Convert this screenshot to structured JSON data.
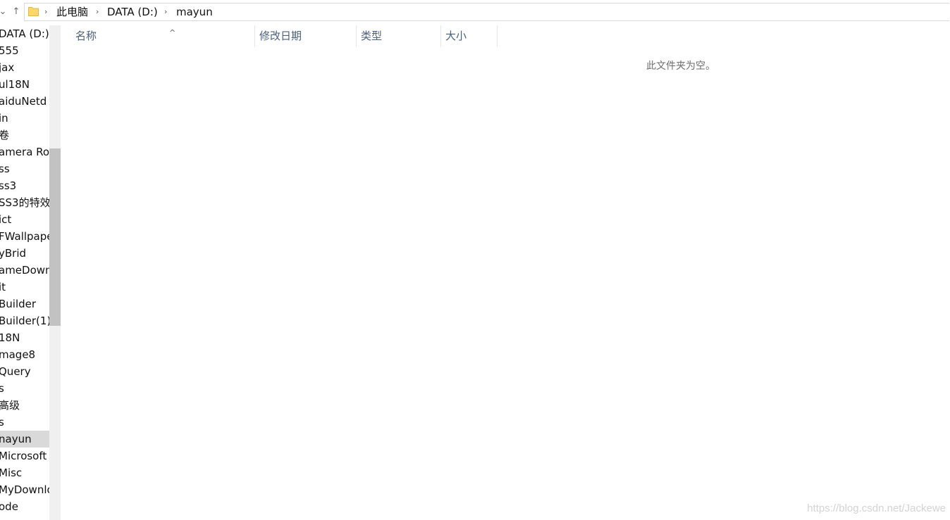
{
  "address_bar": {
    "back_glyph": "⌄",
    "up_glyph": "↑",
    "crumbs": [
      "此电脑",
      "DATA (D:)",
      "mayun"
    ],
    "separator": "›"
  },
  "nav_pane": {
    "items": [
      "DATA (D:)",
      "555",
      "jax",
      "ul18N",
      "aiduNetd",
      "in",
      "卷",
      "amera Ro",
      "ss",
      "ss3",
      "SS3的特效",
      "ict",
      "FWallpape",
      "yBrid",
      "ameDown",
      "it",
      "Builder",
      "Builder(1)",
      "18N",
      "mage8",
      "Query",
      "s",
      "高级",
      "s",
      "nayun",
      "Microsoft V",
      "Misc",
      "MyDownlo",
      "ode"
    ],
    "selected_index": 24
  },
  "columns": [
    "名称",
    "修改日期",
    "类型",
    "大小"
  ],
  "sort_indicator": "^",
  "empty_message": "此文件夹为空。",
  "watermark": "https://blog.csdn.net/Jackewe",
  "colors": {
    "header_text": "#4c607a",
    "selected_bg": "#d9d9d9",
    "scroll_thumb": "#c2c2c2"
  }
}
